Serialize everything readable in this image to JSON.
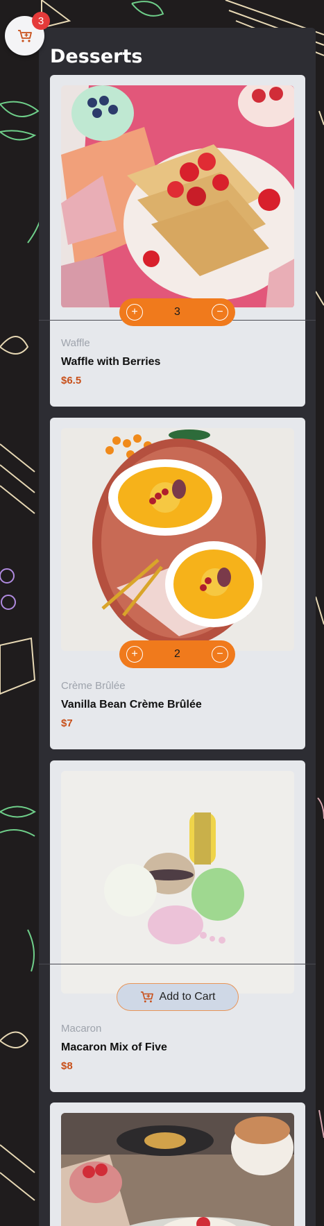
{
  "header": {
    "title": "Desserts"
  },
  "cart": {
    "count": "3",
    "icon": "cart-plus-icon"
  },
  "colors": {
    "accent": "#f07a1c",
    "price": "#c8501a",
    "badge": "#e53a3a",
    "background": "#1f1c1d"
  },
  "products": [
    {
      "category": "Waffle",
      "name": "Waffle with Berries",
      "price": "$6.5",
      "quantity": "3"
    },
    {
      "category": "Crème Brûlée",
      "name": "Vanilla Bean Crème Brûlée",
      "price": "$7",
      "quantity": "2"
    },
    {
      "category": "Macaron",
      "name": "Macaron Mix of Five",
      "price": "$8",
      "add_label": "Add to Cart"
    },
    {
      "category": "",
      "name": "",
      "price": ""
    }
  ]
}
